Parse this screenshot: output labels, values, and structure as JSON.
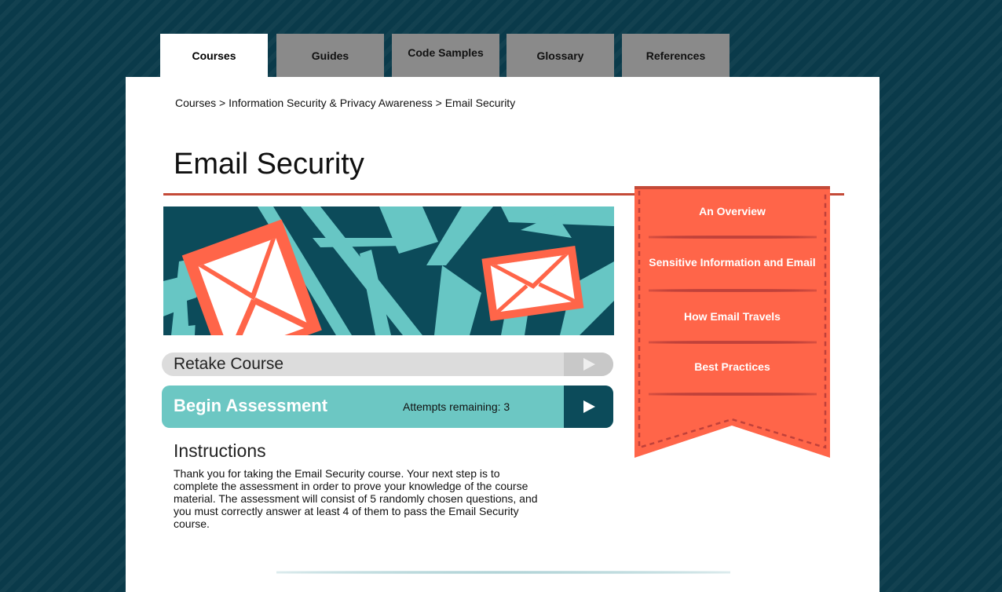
{
  "tabs": [
    {
      "label": "Courses",
      "active": true
    },
    {
      "label": "Guides"
    },
    {
      "label": "Code Samples"
    },
    {
      "label": "Glossary"
    },
    {
      "label": "References"
    }
  ],
  "breadcrumb": {
    "items": [
      "Courses",
      "Information Security & Privacy Awareness",
      "Email Security"
    ],
    "separator": ">"
  },
  "page": {
    "title": "Email Security",
    "banner_icon": "envelope-pattern-illustration"
  },
  "actions": {
    "retake_label": "Retake Course",
    "begin_label": "Begin Assessment",
    "attempts_text": "Attempts remaining: 3"
  },
  "instructions": {
    "heading": "Instructions",
    "body": "Thank you for taking the Email Security course. Your next step is to complete the assessment in order to prove your knowledge of the course material. The assessment will consist of 5 randomly chosen questions, and you must correctly answer at least 4 of them to pass the Email Security course."
  },
  "sections": [
    {
      "label": "An Overview"
    },
    {
      "label": "Sensitive Information and Email"
    },
    {
      "label": "How Email Travels"
    },
    {
      "label": "Best Practices"
    }
  ],
  "colors": {
    "background": "#0a3a4a",
    "accent_red": "#c44a38",
    "ribbon": "#ff6549",
    "teal": "#6cc7c3",
    "dark_teal": "#0c4b5a"
  }
}
